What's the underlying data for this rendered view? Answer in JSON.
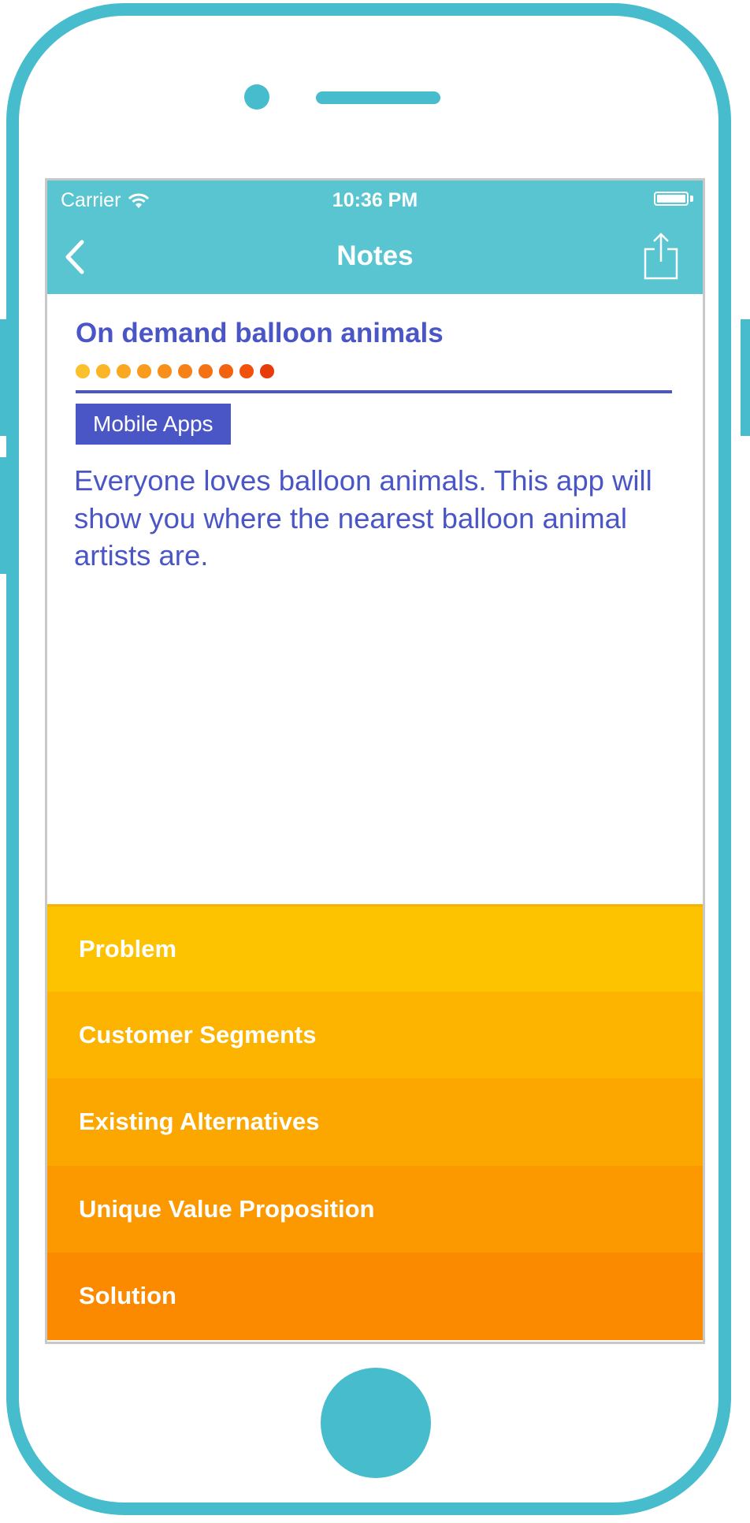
{
  "status_bar": {
    "carrier": "Carrier",
    "time": "10:36 PM",
    "battery_level": 1.0
  },
  "nav": {
    "title": "Notes",
    "back_icon": "chevron-left-icon",
    "share_icon": "share-icon"
  },
  "note": {
    "title": "On demand balloon animals",
    "rating": {
      "filled": 10,
      "total": 10
    },
    "rating_colors": [
      "#fbc02d",
      "#fbb527",
      "#faa822",
      "#f99b1f",
      "#f88f1b",
      "#f68118",
      "#f47214",
      "#f26211",
      "#f0520e",
      "#e83b0a"
    ],
    "category": "Mobile Apps",
    "body": "Everyone loves balloon animals. This app will show you where the nearest balloon animal artists are."
  },
  "sections": [
    {
      "label": "Problem",
      "color": "#fdc200"
    },
    {
      "label": "Customer Segments",
      "color": "#fdb400"
    },
    {
      "label": "Existing Alternatives",
      "color": "#fca600"
    },
    {
      "label": "Unique Value Proposition",
      "color": "#fc9800"
    },
    {
      "label": "Solution",
      "color": "#fb8a00"
    }
  ],
  "colors": {
    "frame": "#47bccc",
    "header": "#59c5d1",
    "accent": "#4a56c6"
  }
}
